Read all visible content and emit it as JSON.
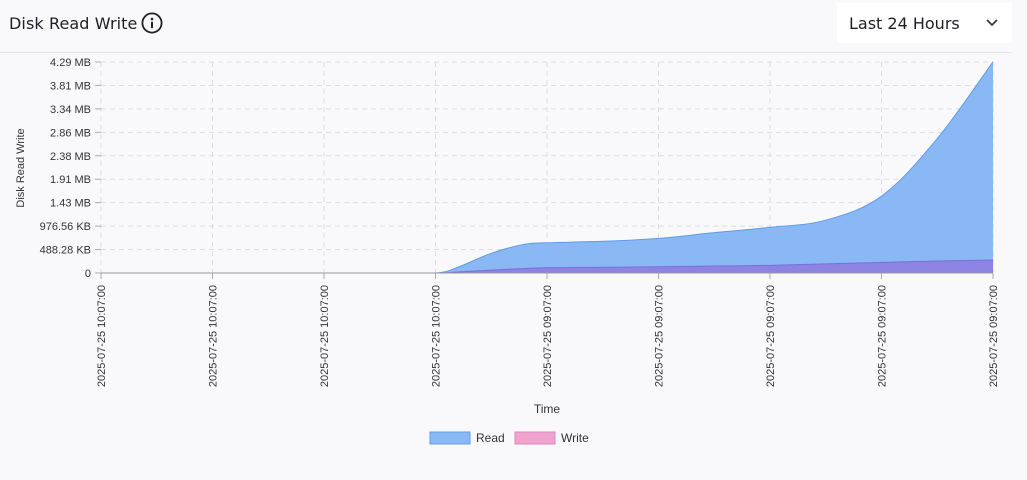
{
  "widget": {
    "title": "Disk Read Write",
    "range": "Last 24 Hours"
  },
  "colors": {
    "read_fill": "#8ab8f5",
    "read_line": "#5f9be8",
    "write_fill": "#8d80e0",
    "write_legend": "#f0a3cf",
    "grid": "#dddddd"
  },
  "chart_data": {
    "type": "area",
    "stacked": true,
    "ylabel": "Disk Read Write",
    "xlabel": "Time",
    "y_ticks": [
      {
        "value": 0,
        "label": "0"
      },
      {
        "value": 488.28,
        "label": "488.28 KB"
      },
      {
        "value": 976.56,
        "label": "976.56 KB"
      },
      {
        "value": 1464.84,
        "label": "1.43 MB"
      },
      {
        "value": 1953.12,
        "label": "1.91 MB"
      },
      {
        "value": 2441.41,
        "label": "2.38 MB"
      },
      {
        "value": 2929.69,
        "label": "2.86 MB"
      },
      {
        "value": 3417.97,
        "label": "3.34 MB"
      },
      {
        "value": 3906.25,
        "label": "3.81 MB"
      },
      {
        "value": 4394.53,
        "label": "4.29 MB"
      }
    ],
    "ylim": [
      0,
      4394.53
    ],
    "y_unit": "KB",
    "x_tick_labels": [
      "2025-07-25 10:07:00",
      "2025-07-25 10:07:00",
      "2025-07-25 10:07:00",
      "2025-07-25 10:07:00",
      "2025-07-25 09:07:00",
      "2025-07-25 09:07:00",
      "2025-07-25 09:07:00",
      "2025-07-25 09:07:00",
      "2025-07-25 09:07:00"
    ],
    "x_interval": 0.5,
    "x": [
      0,
      0.5,
      1,
      1.5,
      2,
      2.5,
      3,
      3.2,
      3.5,
      3.8,
      4,
      4.5,
      5,
      5.5,
      6,
      6.5,
      7,
      7.5,
      8
    ],
    "series": [
      {
        "name": "Read",
        "values": [
          0,
          0,
          0,
          0,
          0,
          0,
          0,
          120,
          410,
          600,
          630,
          660,
          720,
          840,
          950,
          1100,
          1600,
          2800,
          4400
        ]
      },
      {
        "name": "Write",
        "values": [
          0,
          0,
          0,
          0,
          0,
          0,
          0,
          20,
          60,
          95,
          110,
          120,
          130,
          145,
          160,
          190,
          220,
          250,
          270
        ]
      }
    ],
    "legend_position": "bottom",
    "grid": true
  }
}
